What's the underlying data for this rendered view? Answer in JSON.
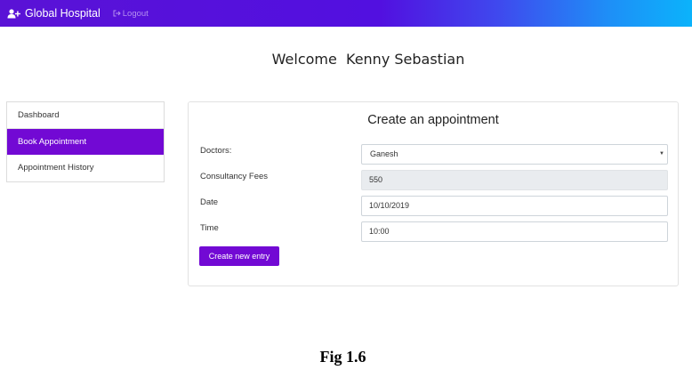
{
  "navbar": {
    "brand": "Global Hospital",
    "brand_icon": "user-plus-icon",
    "logout_label": "Logout",
    "logout_icon": "sign-out-icon",
    "gradient": [
      "#5a12d6",
      "#0bb3fb"
    ]
  },
  "welcome": {
    "text": "Welcome  Kenny Sebastian"
  },
  "sidebar": {
    "items": [
      {
        "label": "Dashboard"
      },
      {
        "label": "Book Appointment",
        "active": true
      },
      {
        "label": "Appointment History"
      }
    ],
    "active_color": "#7209d4"
  },
  "form": {
    "title": "Create an appointment",
    "doctors_label": "Doctors:",
    "doctors_value": "Ganesh",
    "fees_label": "Consultancy Fees",
    "fees_value": "550",
    "date_label": "Date",
    "date_value": "10/10/2019",
    "time_label": "Time",
    "time_value": "10:00",
    "submit_label": "Create new entry"
  },
  "caption": "Fig 1.6"
}
